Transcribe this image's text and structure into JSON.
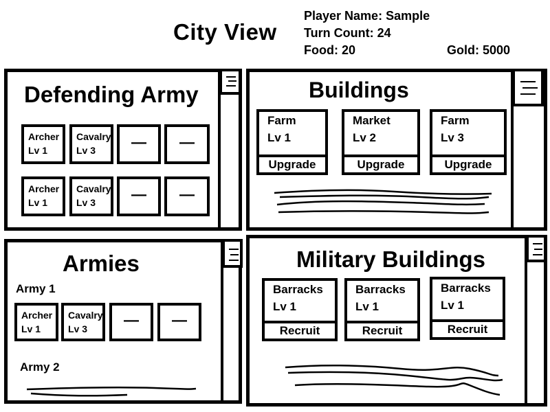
{
  "header": {
    "title": "City View",
    "player_name": "Player Name: Sample",
    "turn_count": "Turn Count: 24",
    "food": "Food: 20",
    "gold": "Gold: 5000"
  },
  "defending_army": {
    "title": "Defending Army",
    "rows": [
      {
        "slots": [
          {
            "name": "Archer",
            "level": "Lv 1"
          },
          {
            "name": "Cavalry",
            "level": "Lv 3"
          },
          {
            "empty": "—"
          },
          {
            "empty": "—"
          }
        ]
      },
      {
        "slots": [
          {
            "name": "Archer",
            "level": "Lv 1"
          },
          {
            "name": "Cavalry",
            "level": "Lv 3"
          },
          {
            "empty": "—"
          },
          {
            "empty": "—"
          }
        ]
      }
    ]
  },
  "buildings": {
    "title": "Buildings",
    "cards": [
      {
        "name": "Farm",
        "level": "Lv 1",
        "action": "Upgrade"
      },
      {
        "name": "Market",
        "level": "Lv 2",
        "action": "Upgrade"
      },
      {
        "name": "Farm",
        "level": "Lv 3",
        "action": "Upgrade"
      }
    ]
  },
  "armies": {
    "title": "Armies",
    "groups": [
      {
        "label": "Army 1",
        "slots": [
          {
            "name": "Archer",
            "level": "Lv 1"
          },
          {
            "name": "Cavalry",
            "level": "Lv 3"
          },
          {
            "empty": "—"
          },
          {
            "empty": "—"
          }
        ]
      },
      {
        "label": "Army 2"
      }
    ]
  },
  "military_buildings": {
    "title": "Military Buildings",
    "cards": [
      {
        "name": "Barracks",
        "level": "Lv 1",
        "action": "Recruit"
      },
      {
        "name": "Barracks",
        "level": "Lv 1",
        "action": "Recruit"
      },
      {
        "name": "Barracks",
        "level": "Lv 1",
        "action": "Recruit"
      }
    ]
  },
  "icons": {
    "scroll_handle": "menu-lines-icon",
    "scribble": "scribble-placeholder"
  }
}
